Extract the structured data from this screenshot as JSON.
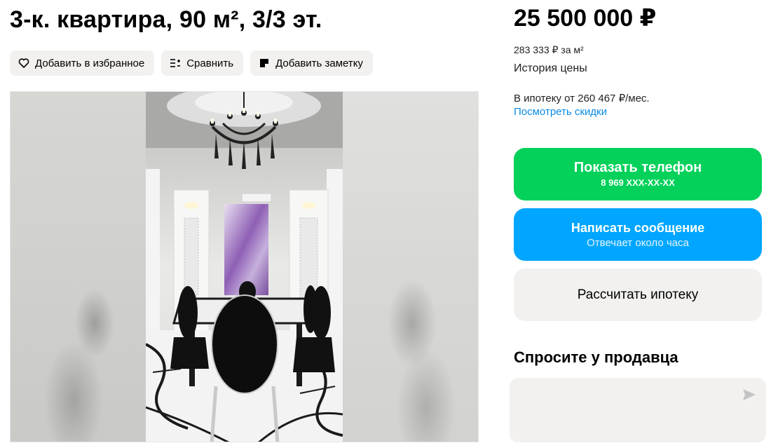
{
  "listing": {
    "title": "3-к. квартира, 90 м², 3/3 эт.",
    "actions": {
      "favorite_label": "Добавить в избранное",
      "compare_label": "Сравнить",
      "note_label": "Добавить заметку"
    }
  },
  "gallery": {
    "photo_icon": "dining-room-photo"
  },
  "pricing": {
    "price": "25 500 000 ₽",
    "per_m2": "283 333 ₽ за м²",
    "history_label": "История цены",
    "mortgage_text": "В ипотеку от 260 467 ₽/мес.",
    "discounts_link": "Посмотреть скидки"
  },
  "contact": {
    "phone_button_label": "Показать телефон",
    "phone_number": "8 969 XXX-XX-XX",
    "message_button_label": "Написать сообщение",
    "message_subtitle": "Отвечает около часа",
    "calc_button_label": "Рассчитать ипотеку"
  },
  "ask_seller": {
    "title": "Спросите у продавца",
    "send_icon": "send-icon"
  },
  "colors": {
    "green": "#03d15a",
    "blue": "#00a6ff",
    "link": "#0a8ae6",
    "button_bg": "#f2f1f0"
  }
}
